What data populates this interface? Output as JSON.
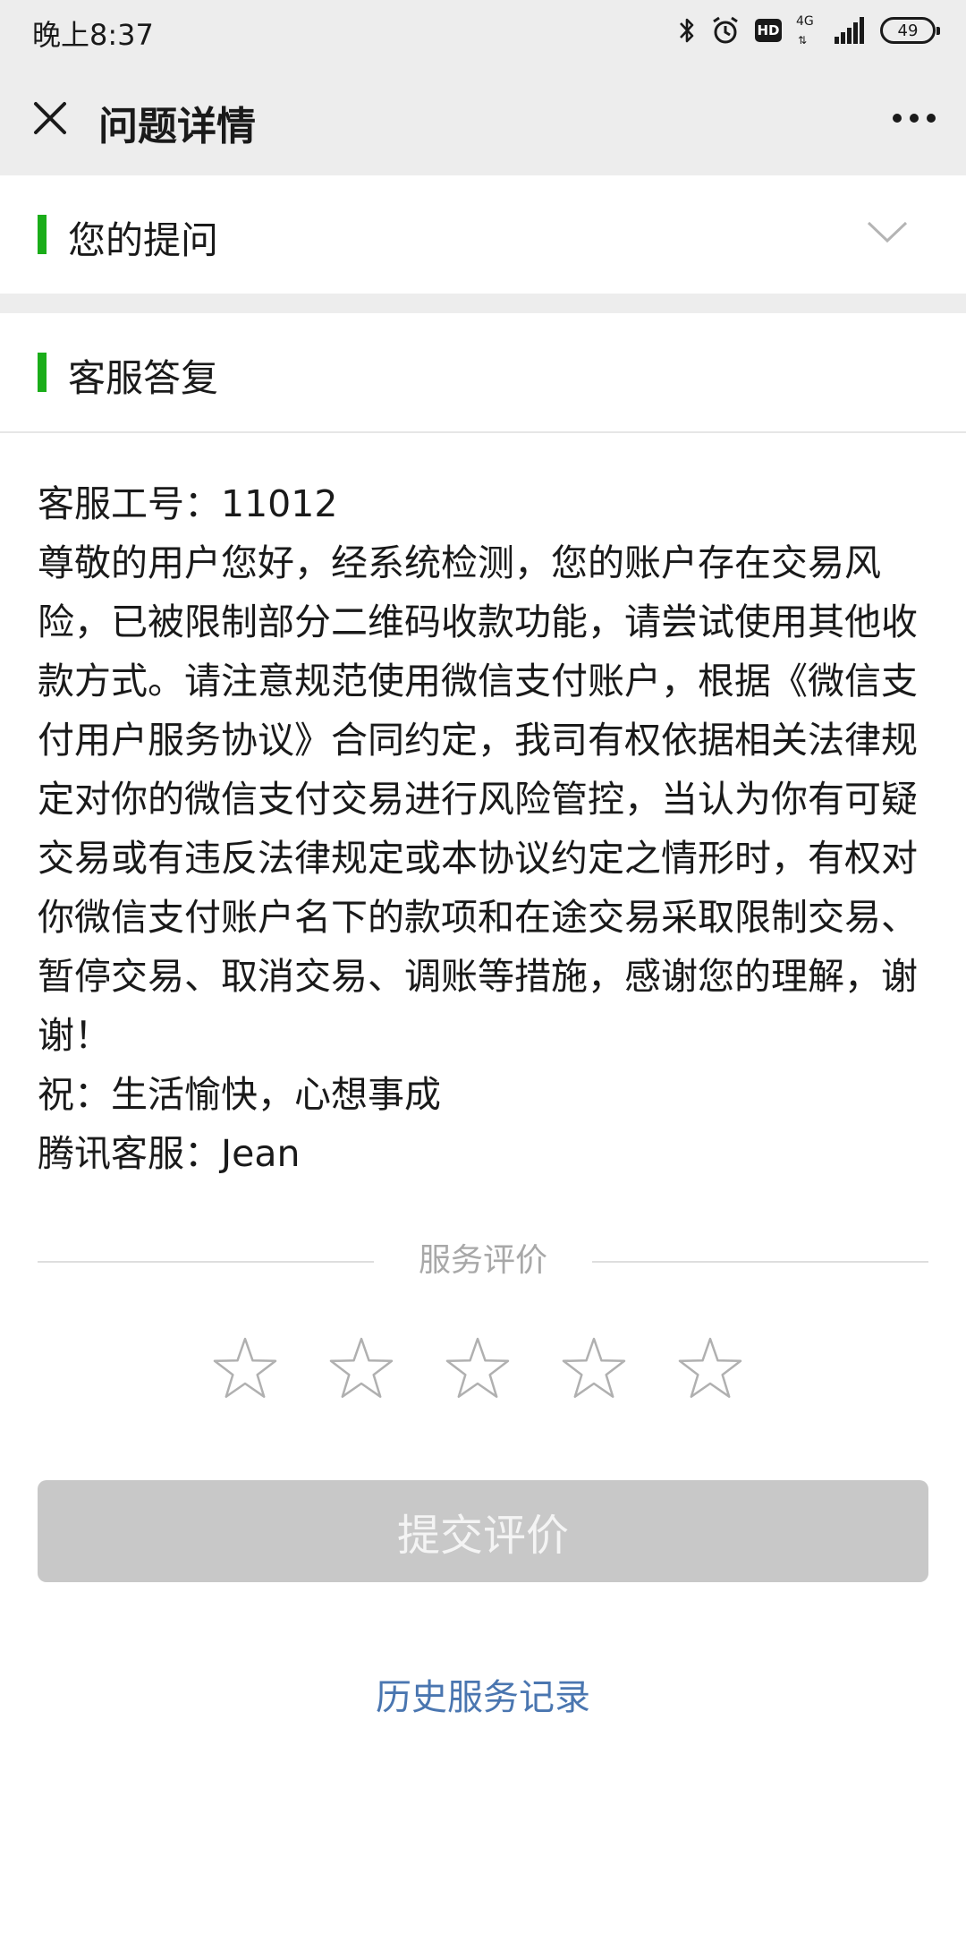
{
  "status_bar": {
    "time": "晚上8:37",
    "icons": [
      "bluetooth-icon",
      "alarm-icon",
      "hd-icon",
      "4g-icon",
      "signal-icon",
      "battery-icon"
    ],
    "hd_label": "HD",
    "network_label": "4G",
    "network_arrows": "⇅",
    "battery_level": "49"
  },
  "header": {
    "title": "问题详情",
    "close_icon": "close-icon",
    "more_icon": "more-icon"
  },
  "question_section": {
    "label": "您的提问",
    "toggle_icon": "chevron-down-icon"
  },
  "answer_section": {
    "label": "客服答复",
    "lines": [
      "客服工号：11012",
      "尊敬的用户您好，经系统检测，您的账户存在交易风险，已被限制部分二维码收款功能，请尝试使用其他收款方式。请注意规范使用微信支付账户，根据《微信支付用户服务协议》合同约定，我司有权依据相关法律规定对你的微信支付交易进行风险管控，当认为你有可疑交易或有违反法律规定或本协议约定之情形时，有权对你微信支付账户名下的款项和在途交易采取限制交易、暂停交易、取消交易、调账等措施，感谢您的理解，谢谢！",
      "祝：生活愉快，心想事成",
      "腾讯客服：Jean"
    ]
  },
  "rating": {
    "title": "服务评价",
    "star_count": 5,
    "selected": 0
  },
  "submit_label": "提交评价",
  "history_link": "历史服务记录",
  "colors": {
    "accent_green": "#1aad19",
    "link_blue": "#4a76b0",
    "disabled_button": "#c8c8c8",
    "page_gray": "#ededed"
  }
}
